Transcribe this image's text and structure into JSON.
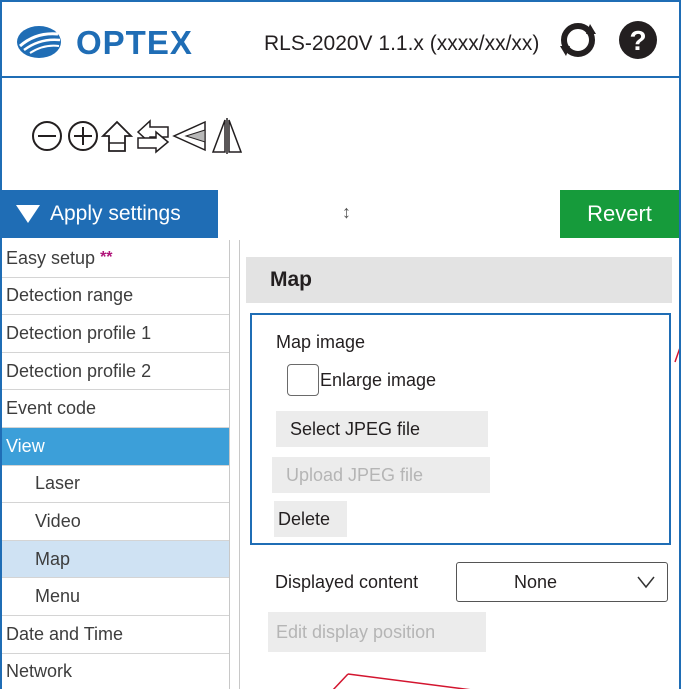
{
  "header": {
    "logo_text": "OPTEX",
    "version": "RLS-2020V 1.1.x (xxxx/xx/xx)",
    "icons": [
      "refresh-icon",
      "help-icon"
    ]
  },
  "toolbar": {
    "tools": [
      "zoom-out-icon",
      "zoom-in-icon",
      "home-icon",
      "swap-arrows-icon",
      "angle-icon",
      "mirror-icon"
    ]
  },
  "apply_bar": {
    "apply_label": "Apply settings",
    "resize_glyph": "↕",
    "revert_label": "Revert"
  },
  "sidebar": {
    "items": [
      {
        "label": "Easy setup",
        "marker": "**"
      },
      {
        "label": "Detection range"
      },
      {
        "label": "Detection profile 1"
      },
      {
        "label": "Detection profile 2"
      },
      {
        "label": "Event code"
      },
      {
        "label": "View"
      },
      {
        "label": "Laser"
      },
      {
        "label": "Video"
      },
      {
        "label": "Map"
      },
      {
        "label": "Menu"
      },
      {
        "label": "Date and Time"
      },
      {
        "label": "Network"
      }
    ]
  },
  "main": {
    "section_title": "Map",
    "map_image": {
      "title": "Map image",
      "enlarge_label": "Enlarge image",
      "enlarge_checked": false,
      "select_label": "Select JPEG file",
      "upload_label": "Upload JPEG file",
      "delete_label": "Delete"
    },
    "displayed_content_label": "Displayed content",
    "displayed_content_value": "None",
    "edit_position_label": "Edit display position"
  },
  "colors": {
    "brand_blue": "#1f6db5",
    "active_blue": "#3c9fd9",
    "selected_bg": "#cfe2f3",
    "revert_green": "#169b3b",
    "callout_red": "#d3152f",
    "stars_magenta": "#b0167a"
  }
}
